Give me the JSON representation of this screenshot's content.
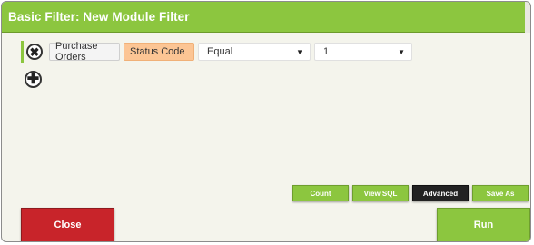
{
  "dialog": {
    "title": "Basic Filter: New Module Filter"
  },
  "filter_row": {
    "remove_glyph": "✖",
    "module": "Purchase Orders",
    "field": "Status Code",
    "operator": {
      "selected": "Equal"
    },
    "value": {
      "selected": "1"
    },
    "dropdown_glyph": "▼"
  },
  "add_glyph": "✚",
  "actions": {
    "count_label": "Count",
    "viewsql_label": "View SQL",
    "advanced_label": "Advanced",
    "saveas_label": "Save As",
    "close_label": "Close",
    "run_label": "Run"
  },
  "colors": {
    "accent_green": "#8cc63f",
    "close_red": "#c8242a",
    "field_chip": "#fcc594",
    "advanced_dark": "#222222"
  },
  "icons": {
    "remove": "remove-filter-icon",
    "add": "add-filter-icon",
    "dropdown": "chevron-down-icon"
  }
}
